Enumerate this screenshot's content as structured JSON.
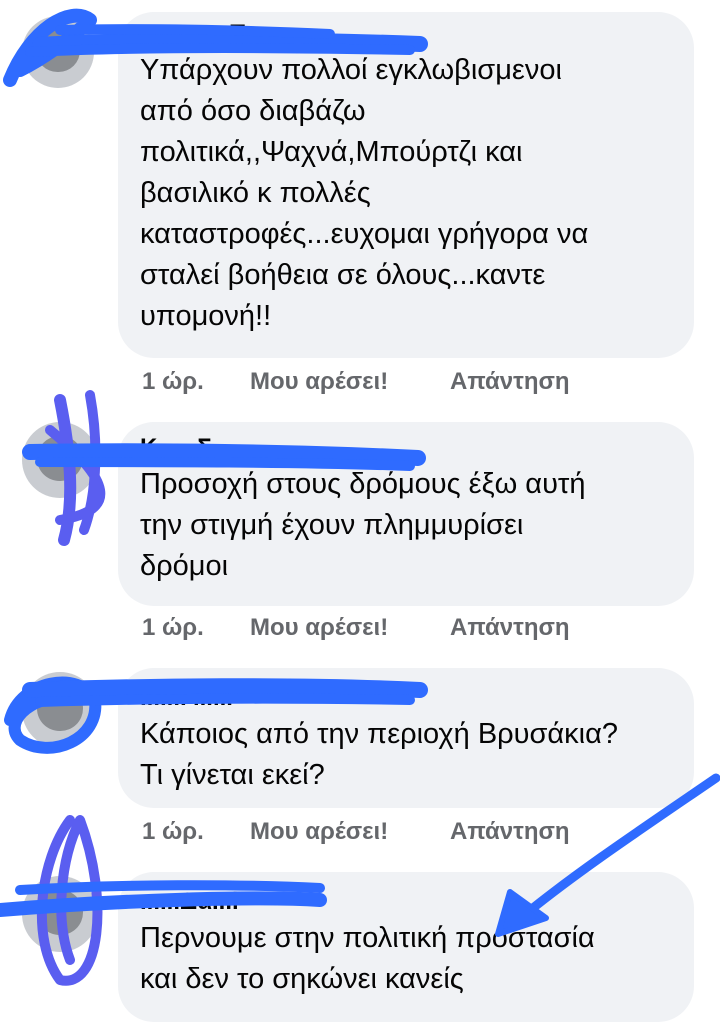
{
  "comments": [
    {
      "author": "Αν......ς Π...ς",
      "text": "Υπάρχουν πολλοί  εγκλωβισμενοι\nαπό όσο διαβάζω\nπολιτικά,,Ψαχνά,Μπούρτζι και\nβασιλικό  κ πολλές\nκαταστροφές...ευχομαι γρήγορα να\nσταλεί βοήθεια σε όλους...καντε\nυπομονή!!",
      "time": "1 ώρ.",
      "like": "Μου αρέσει!",
      "reply": "Απάντηση"
    },
    {
      "author": "Κ......Σ......",
      "text": "Προσοχή στους δρόμους έξω αυτή\nτην στιγμή έχουν πλημμυρίσει\nδρόμοι",
      "time": "1 ώρ.",
      "like": "Μου αρέσει!",
      "reply": "Απάντηση"
    },
    {
      "author": "......Ρ......",
      "text": "Κάποιος από την περιοχή Βρυσάκια?\nΤι γίνεται εκεί?",
      "time": "1 ώρ.",
      "like": "Μου αρέσει!",
      "reply": "Απάντηση"
    },
    {
      "author": "......Δα...l",
      "text": "Περνουμε στην πολιτική προστασία\nκαι δεν το σηκώνει κανείς",
      "time": "",
      "like": "",
      "reply": ""
    }
  ],
  "colors": {
    "bubble": "#f0f2f5",
    "scribble": "#2f6bff",
    "scribble_alt": "#5a5ef0",
    "action_text": "#65676b"
  },
  "overlays": [
    "redaction-scribble",
    "arrow-annotation"
  ]
}
